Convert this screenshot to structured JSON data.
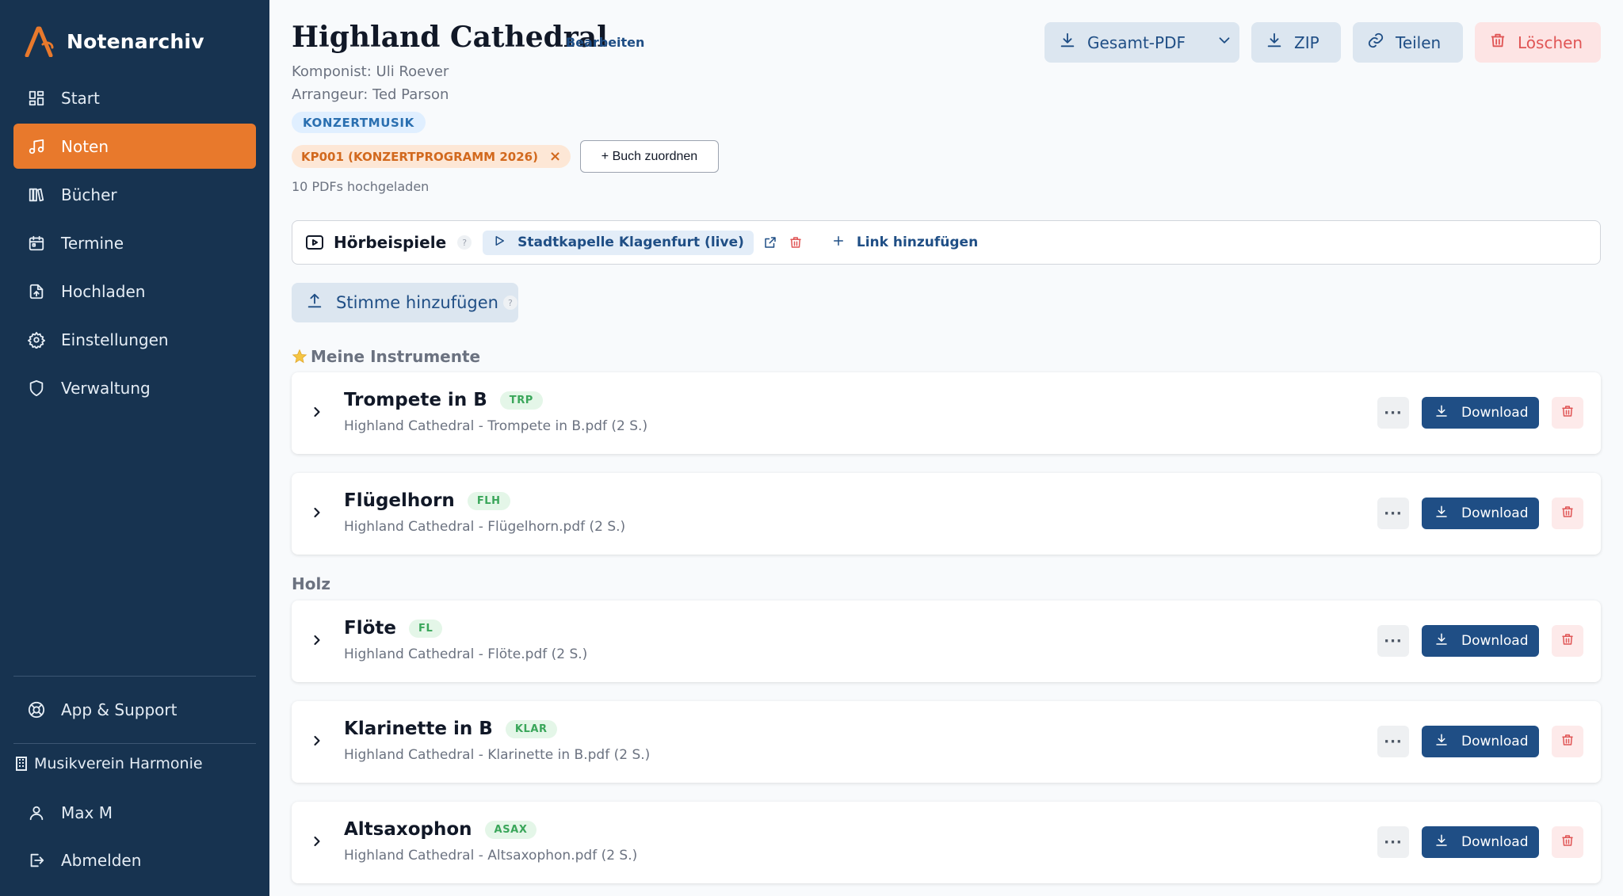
{
  "sidebar": {
    "brand": "Notenarchiv",
    "items": [
      {
        "label": "Start",
        "icon": "dashboard-icon"
      },
      {
        "label": "Noten",
        "icon": "music-icon",
        "active": true
      },
      {
        "label": "Bücher",
        "icon": "books-icon"
      },
      {
        "label": "Termine",
        "icon": "calendar-icon"
      },
      {
        "label": "Hochladen",
        "icon": "upload-file-icon"
      },
      {
        "label": "Einstellungen",
        "icon": "gear-icon"
      },
      {
        "label": "Verwaltung",
        "icon": "shield-icon"
      }
    ],
    "support": "App & Support",
    "organization": "Musikverein Harmonie",
    "user": "Max M",
    "logout": "Abmelden"
  },
  "piece": {
    "title": "Highland Cathedral",
    "edit": "Bearbeiten",
    "composer": "Komponist: Uli Roever",
    "arranger": "Arrangeur: Ted Parson",
    "genre": "KONZERTMUSIK",
    "book": "KP001 (KONZERTPROGRAMM 2026)",
    "book_remove": "×",
    "assign_book": "+ Buch zuordnen",
    "upload_count": "10 PDFs hochgeladen"
  },
  "toolbar": {
    "pdf": "Gesamt-PDF",
    "zip": "ZIP",
    "share": "Teilen",
    "delete": "Löschen"
  },
  "audio": {
    "title": "Hörbeispiele",
    "help": "?",
    "link_label": "Stadtkapelle Klagenfurt (live)",
    "add_link": "Link hinzufügen"
  },
  "add_voice": {
    "label": "Stimme hinzufügen",
    "help": "?"
  },
  "sections": {
    "mine": "Meine Instrumente",
    "mine_icon": "star-icon",
    "wood": "Holz"
  },
  "voices": [
    {
      "name": "Trompete in B",
      "abbr": "TRP",
      "file": "Highland Cathedral - Trompete in B.pdf (2 S.)"
    },
    {
      "name": "Flügelhorn",
      "abbr": "FLH",
      "file": "Highland Cathedral - Flügelhorn.pdf (2 S.)"
    },
    {
      "name": "Flöte",
      "abbr": "FL",
      "file": "Highland Cathedral - Flöte.pdf (2 S.)"
    },
    {
      "name": "Klarinette in B",
      "abbr": "KLAR",
      "file": "Highland Cathedral - Klarinette in B.pdf (2 S.)"
    },
    {
      "name": "Altsaxophon",
      "abbr": "ASAX",
      "file": "Highland Cathedral - Altsaxophon.pdf (2 S.)"
    }
  ],
  "voice_actions": {
    "more": "···",
    "download": "Download"
  },
  "colors": {
    "sidebar_bg": "#173350",
    "accent": "#e8792c",
    "primary": "#1f4e85",
    "danger": "#e05555"
  }
}
